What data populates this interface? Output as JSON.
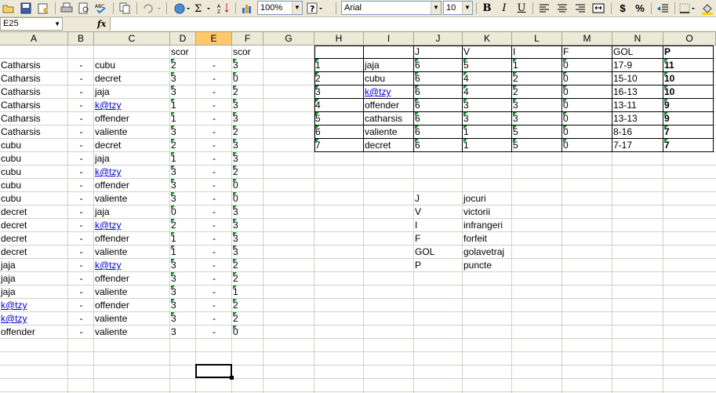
{
  "toolbar": {
    "zoom": "100%",
    "font_name": "Arial",
    "font_size": "10",
    "bold": "B",
    "italic": "I",
    "underline": "U",
    "currency": "$",
    "percent": "%",
    "icons": [
      "open-icon",
      "save-icon",
      "permission-icon",
      "print-icon",
      "print-preview-icon",
      "spelling-icon",
      "copy-icon",
      "undo-icon",
      "hyperlink-icon",
      "autosum-icon",
      "sort-icon",
      "chart-icon",
      "help-icon",
      "align-left-icon",
      "center-icon",
      "align-right-icon",
      "merge-icon",
      "decrease-indent-icon",
      "borders-icon",
      "fill-color-icon"
    ]
  },
  "formula_bar": {
    "name_box": "E25",
    "fx_label": "fx",
    "formula": ""
  },
  "column_headers": [
    "A",
    "B",
    "C",
    "D",
    "E",
    "F",
    "G",
    "H",
    "I",
    "J",
    "K",
    "L",
    "M",
    "N",
    "O"
  ],
  "selected_column": "E",
  "row1": {
    "d": "scor",
    "f": "scor"
  },
  "matches": [
    {
      "home": "Catharsis",
      "sep": "-",
      "away": "cubu",
      "hs": "2",
      "dash": "-",
      "as": "3"
    },
    {
      "home": "Catharsis",
      "sep": "-",
      "away": "decret",
      "hs": "3",
      "dash": "-",
      "as": "0"
    },
    {
      "home": "Catharsis",
      "sep": "-",
      "away": "jaja",
      "hs": "3",
      "dash": "-",
      "as": "2"
    },
    {
      "home": "Catharsis",
      "sep": "-",
      "away": "k@tzy",
      "hs": "1",
      "dash": "-",
      "as": "3"
    },
    {
      "home": "Catharsis",
      "sep": "-",
      "away": "offender",
      "hs": "1",
      "dash": "-",
      "as": "3"
    },
    {
      "home": "Catharsis",
      "sep": "-",
      "away": "valiente",
      "hs": "3",
      "dash": "-",
      "as": "2"
    },
    {
      "home": "cubu",
      "sep": "-",
      "away": "decret",
      "hs": "2",
      "dash": "-",
      "as": "3"
    },
    {
      "home": "cubu",
      "sep": "-",
      "away": "jaja",
      "hs": "1",
      "dash": "-",
      "as": "3"
    },
    {
      "home": "cubu",
      "sep": "-",
      "away": "k@tzy",
      "hs": "3",
      "dash": "-",
      "as": "2"
    },
    {
      "home": "cubu",
      "sep": "-",
      "away": "offender",
      "hs": "3",
      "dash": "-",
      "as": "0"
    },
    {
      "home": "cubu",
      "sep": "-",
      "away": "valiente",
      "hs": "3",
      "dash": "-",
      "as": "0"
    },
    {
      "home": "decret",
      "sep": "-",
      "away": "jaja",
      "hs": "0",
      "dash": "-",
      "as": "3"
    },
    {
      "home": "decret",
      "sep": "-",
      "away": "k@tzy",
      "hs": "2",
      "dash": "-",
      "as": "3"
    },
    {
      "home": "decret",
      "sep": "-",
      "away": "offender",
      "hs": "1",
      "dash": "-",
      "as": "3"
    },
    {
      "home": "decret",
      "sep": "-",
      "away": "valiente",
      "hs": "1",
      "dash": "-",
      "as": "3"
    },
    {
      "home": "jaja",
      "sep": "-",
      "away": "k@tzy",
      "hs": "3",
      "dash": "-",
      "as": "2"
    },
    {
      "home": "jaja",
      "sep": "-",
      "away": "offender",
      "hs": "3",
      "dash": "-",
      "as": "2"
    },
    {
      "home": "jaja",
      "sep": "-",
      "away": "valiente",
      "hs": "3",
      "dash": "-",
      "as": "1"
    },
    {
      "home": "k@tzy",
      "sep": "-",
      "away": "offender",
      "hs": "3",
      "dash": "-",
      "as": "2"
    },
    {
      "home": "k@tzy",
      "sep": "-",
      "away": "valiente",
      "hs": "3",
      "dash": "-",
      "as": "2"
    },
    {
      "home": "offender",
      "sep": "-",
      "away": "valiente",
      "hs": "3",
      "dash": "-",
      "as": "0"
    }
  ],
  "standings_header": {
    "j": "J",
    "v": "V",
    "i": "I",
    "f": "F",
    "gol": "GOL",
    "p": "P"
  },
  "standings": [
    {
      "rank": "1",
      "team": "jaja",
      "j": "6",
      "v": "5",
      "i": "1",
      "f": "0",
      "gol": "17-9",
      "p": "11"
    },
    {
      "rank": "2",
      "team": "cubu",
      "j": "6",
      "v": "4",
      "i": "2",
      "f": "0",
      "gol": "15-10",
      "p": "10"
    },
    {
      "rank": "3",
      "team": "k@tzy",
      "j": "6",
      "v": "4",
      "i": "2",
      "f": "0",
      "gol": "16-13",
      "p": "10"
    },
    {
      "rank": "4",
      "team": "offender",
      "j": "6",
      "v": "3",
      "i": "3",
      "f": "0",
      "gol": "13-11",
      "p": "9"
    },
    {
      "rank": "5",
      "team": "catharsis",
      "j": "6",
      "v": "3",
      "i": "3",
      "f": "0",
      "gol": "13-13",
      "p": "9"
    },
    {
      "rank": "6",
      "team": "valiente",
      "j": "6",
      "v": "1",
      "i": "5",
      "f": "0",
      "gol": "8-16",
      "p": "7"
    },
    {
      "rank": "7",
      "team": "decret",
      "j": "6",
      "v": "1",
      "i": "5",
      "f": "0",
      "gol": "7-17",
      "p": "7"
    }
  ],
  "legend": [
    {
      "abbr": "J",
      "meaning": "jocuri"
    },
    {
      "abbr": "V",
      "meaning": "victorii"
    },
    {
      "abbr": "I",
      "meaning": "infrangeri"
    },
    {
      "abbr": "F",
      "meaning": "forfeit"
    },
    {
      "abbr": "GOL",
      "meaning": "golavetraj"
    },
    {
      "abbr": "P",
      "meaning": "puncte"
    }
  ],
  "colors": {
    "link": "#0000cc",
    "indicator": "#0a8a2a",
    "selected_header": "#ffc86a"
  }
}
